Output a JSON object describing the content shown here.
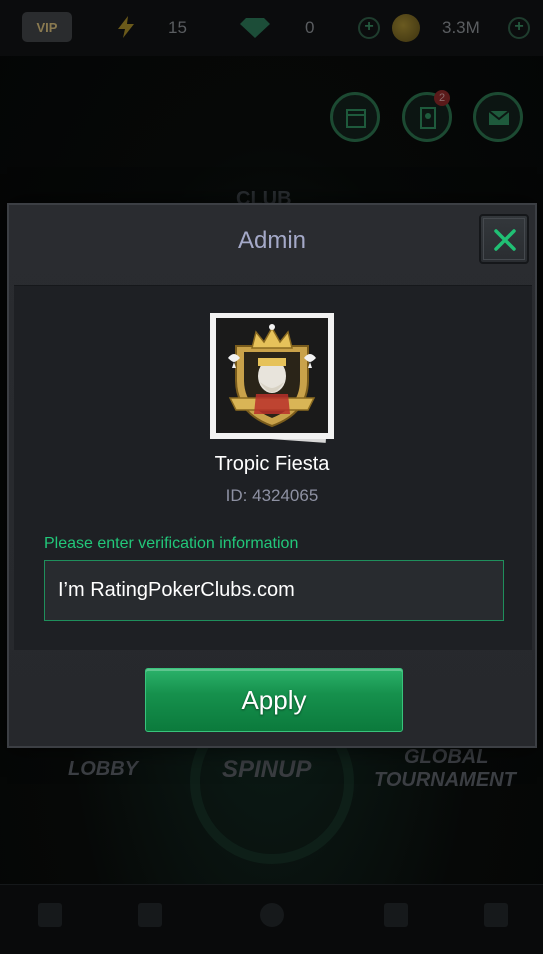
{
  "topbar": {
    "vip_label": "VIP",
    "energy": "15",
    "gems": "0",
    "coins": "3.3M"
  },
  "background": {
    "club_label": "CLUB",
    "lobby_label": "LOBBY",
    "spinup_label": "SPINUP",
    "global_label": "GLOBAL",
    "tournament_label": "TOURNAMENT",
    "notification_count": "2"
  },
  "modal": {
    "title": "Admin",
    "club_name": "Tropic Fiesta",
    "club_id": "ID: 4324065",
    "verify_label": "Please enter verification information",
    "verify_value": "I’m RatingPokerClubs.com",
    "apply_label": "Apply"
  },
  "colors": {
    "accent_green": "#22c77a",
    "title_lavender": "#a4a9c8",
    "modal_bg": "#2a2c30"
  }
}
